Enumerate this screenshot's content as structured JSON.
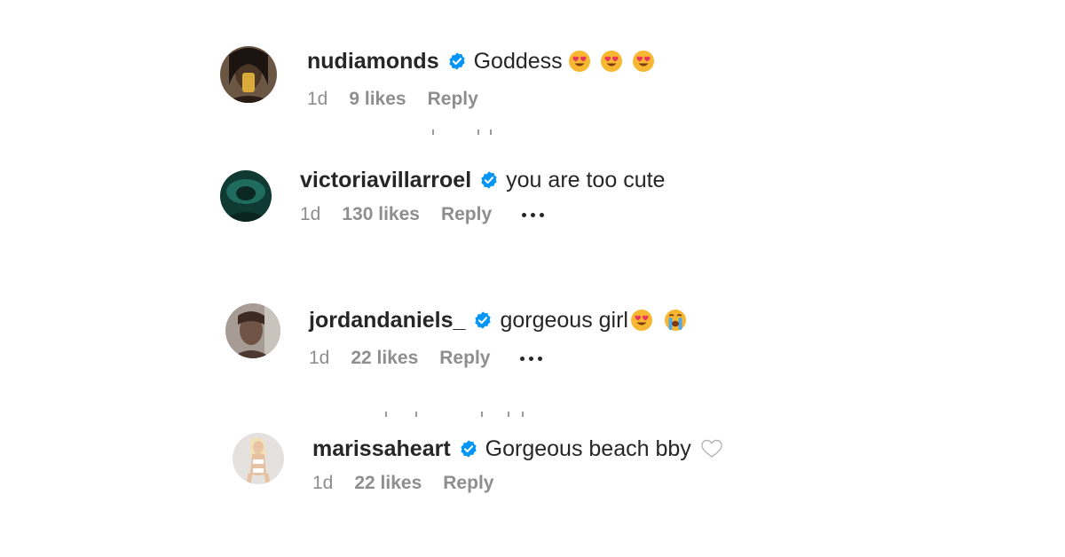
{
  "comments": [
    {
      "username": "nudiamonds",
      "text": "Goddess",
      "emojis": [
        "heart-eyes-emoji",
        "heart-eyes-emoji",
        "heart-eyes-emoji"
      ],
      "time": "1d",
      "likes": "9 likes",
      "reply": "Reply",
      "has_more": false
    },
    {
      "username": "victoriavillarroel",
      "text": "you are too cute",
      "emojis": [],
      "time": "1d",
      "likes": "130 likes",
      "reply": "Reply",
      "has_more": true
    },
    {
      "username": "jordandaniels_",
      "text": "gorgeous girl",
      "emojis": [
        "heart-eyes-emoji",
        "crying-face-emoji"
      ],
      "time": "1d",
      "likes": "22 likes",
      "reply": "Reply",
      "has_more": true
    },
    {
      "username": "marissaheart",
      "text": "Gorgeous beach bby",
      "emojis": [
        "white-heart-icon"
      ],
      "time": "1d",
      "likes": "22 likes",
      "reply": "Reply",
      "has_more": false
    }
  ],
  "icons": {
    "verified": "verified-badge-icon",
    "more": "more-options-icon"
  },
  "colors": {
    "verified_blue": "#0095f6",
    "text": "#262626",
    "meta": "#8e8e8e",
    "background": "#ffffff"
  }
}
